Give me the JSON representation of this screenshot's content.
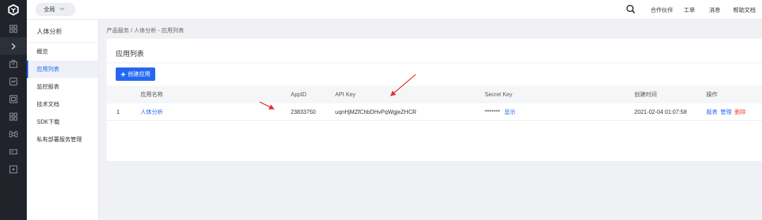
{
  "rail": {
    "icons": [
      "logo-icon",
      "dashboard-icon",
      "expand-icon",
      "product-icon",
      "monitor-icon",
      "resource-icon",
      "grid-icon",
      "command-icon",
      "certificate-icon",
      "media-icon"
    ]
  },
  "topbar": {
    "scope_label": "全局",
    "links": [
      "合作伙伴",
      "工单",
      "消息",
      "帮助文档"
    ]
  },
  "sidebar": {
    "title": "人体分析",
    "items": [
      {
        "label": "概览"
      },
      {
        "label": "应用列表"
      },
      {
        "label": "监控报表"
      },
      {
        "label": "技术文档"
      },
      {
        "label": "SDK下载"
      },
      {
        "label": "私有部署服务管理"
      }
    ]
  },
  "breadcrumb": "产品服务 / 人体分析 - 应用列表",
  "panel": {
    "title": "应用列表",
    "create_button": "创建应用"
  },
  "table": {
    "headers": [
      "应用名称",
      "AppID",
      "API Key",
      "Secret Key",
      "创建时间",
      "操作"
    ],
    "rows": [
      {
        "index": "1",
        "name": "人体分析",
        "appid": "23833750",
        "api_key": "uqnHjMZfChbDHvPqWgjeZHCR",
        "secret_mask": "*******",
        "secret_show": "显示",
        "created": "2021-02-04 01:07:58",
        "ops": [
          "报表",
          "管理",
          "删除"
        ]
      }
    ]
  },
  "colors": {
    "primary": "#2468f2",
    "danger": "#f33e3e",
    "rail_bg": "#20232a",
    "annotation": "#e5322d"
  }
}
